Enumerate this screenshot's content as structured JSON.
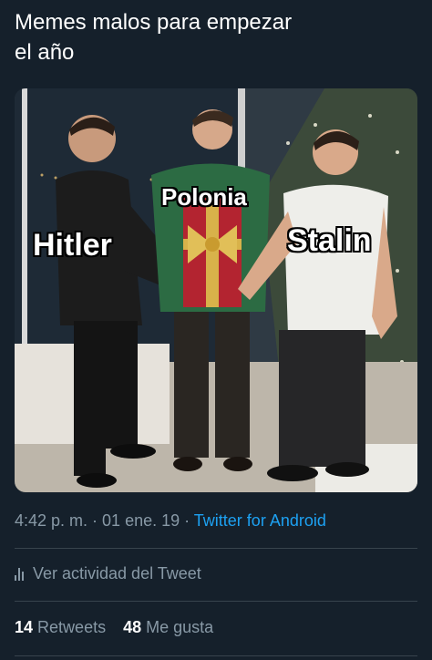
{
  "tweet": {
    "text": "Memes malos para empezar\nel año"
  },
  "meme": {
    "labels": {
      "left": "Hitler",
      "center": "Polonia",
      "right": "Stalin"
    }
  },
  "meta": {
    "time": "4:42 p. m.",
    "sep1": " · ",
    "date": "01 ene. 19",
    "sep2": " · ",
    "client": "Twitter for Android"
  },
  "activity": {
    "label": "Ver actividad del Tweet",
    "icon": "bar-chart-icon"
  },
  "stats": {
    "retweets_count": "14",
    "retweets_label": "Retweets",
    "likes_count": "48",
    "likes_label": "Me gusta"
  },
  "colors": {
    "background": "#15202b",
    "secondary_text": "#8899a6",
    "link": "#1da1f2",
    "divider": "#38444d"
  }
}
